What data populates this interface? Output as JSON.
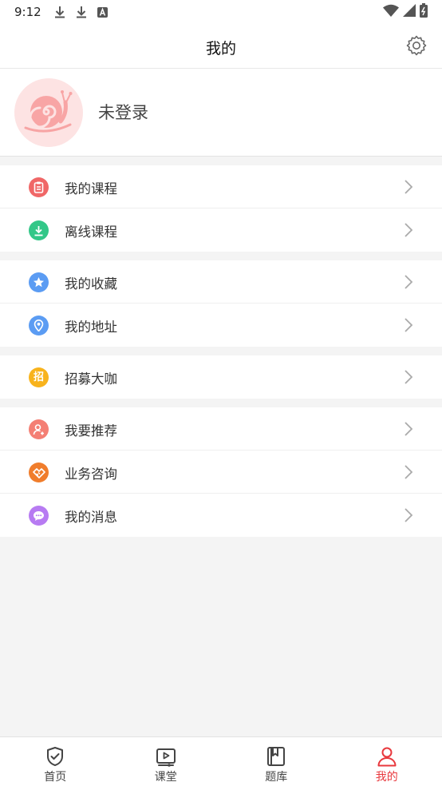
{
  "status_bar": {
    "time": "9:12"
  },
  "header": {
    "title": "我的"
  },
  "profile": {
    "name": "未登录"
  },
  "menu_groups": [
    [
      {
        "label": "我的课程",
        "icon": "clipboard-icon",
        "color": "#f06767"
      },
      {
        "label": "离线课程",
        "icon": "download-icon",
        "color": "#33c788"
      }
    ],
    [
      {
        "label": "我的收藏",
        "icon": "star-icon",
        "color": "#5b9cf3"
      },
      {
        "label": "我的地址",
        "icon": "location-pin-icon",
        "color": "#5b9cf3"
      }
    ],
    [
      {
        "label": "招募大咖",
        "icon": "recruit-icon",
        "color": "#f8b31c",
        "glyph": "招"
      }
    ],
    [
      {
        "label": "我要推荐",
        "icon": "user-plus-icon",
        "color": "#f47f74"
      },
      {
        "label": "业务咨询",
        "icon": "handshake-icon",
        "color": "#f07d2c"
      },
      {
        "label": "我的消息",
        "icon": "chat-bubble-icon",
        "color": "#b77bf2"
      }
    ]
  ],
  "tabbar": {
    "tabs": [
      {
        "label": "首页",
        "icon": "shield-check-icon",
        "active": false
      },
      {
        "label": "课堂",
        "icon": "video-play-icon",
        "active": false
      },
      {
        "label": "题库",
        "icon": "book-bookmark-icon",
        "active": false
      },
      {
        "label": "我的",
        "icon": "user-icon",
        "active": true
      }
    ],
    "active_color": "#e8383d"
  }
}
